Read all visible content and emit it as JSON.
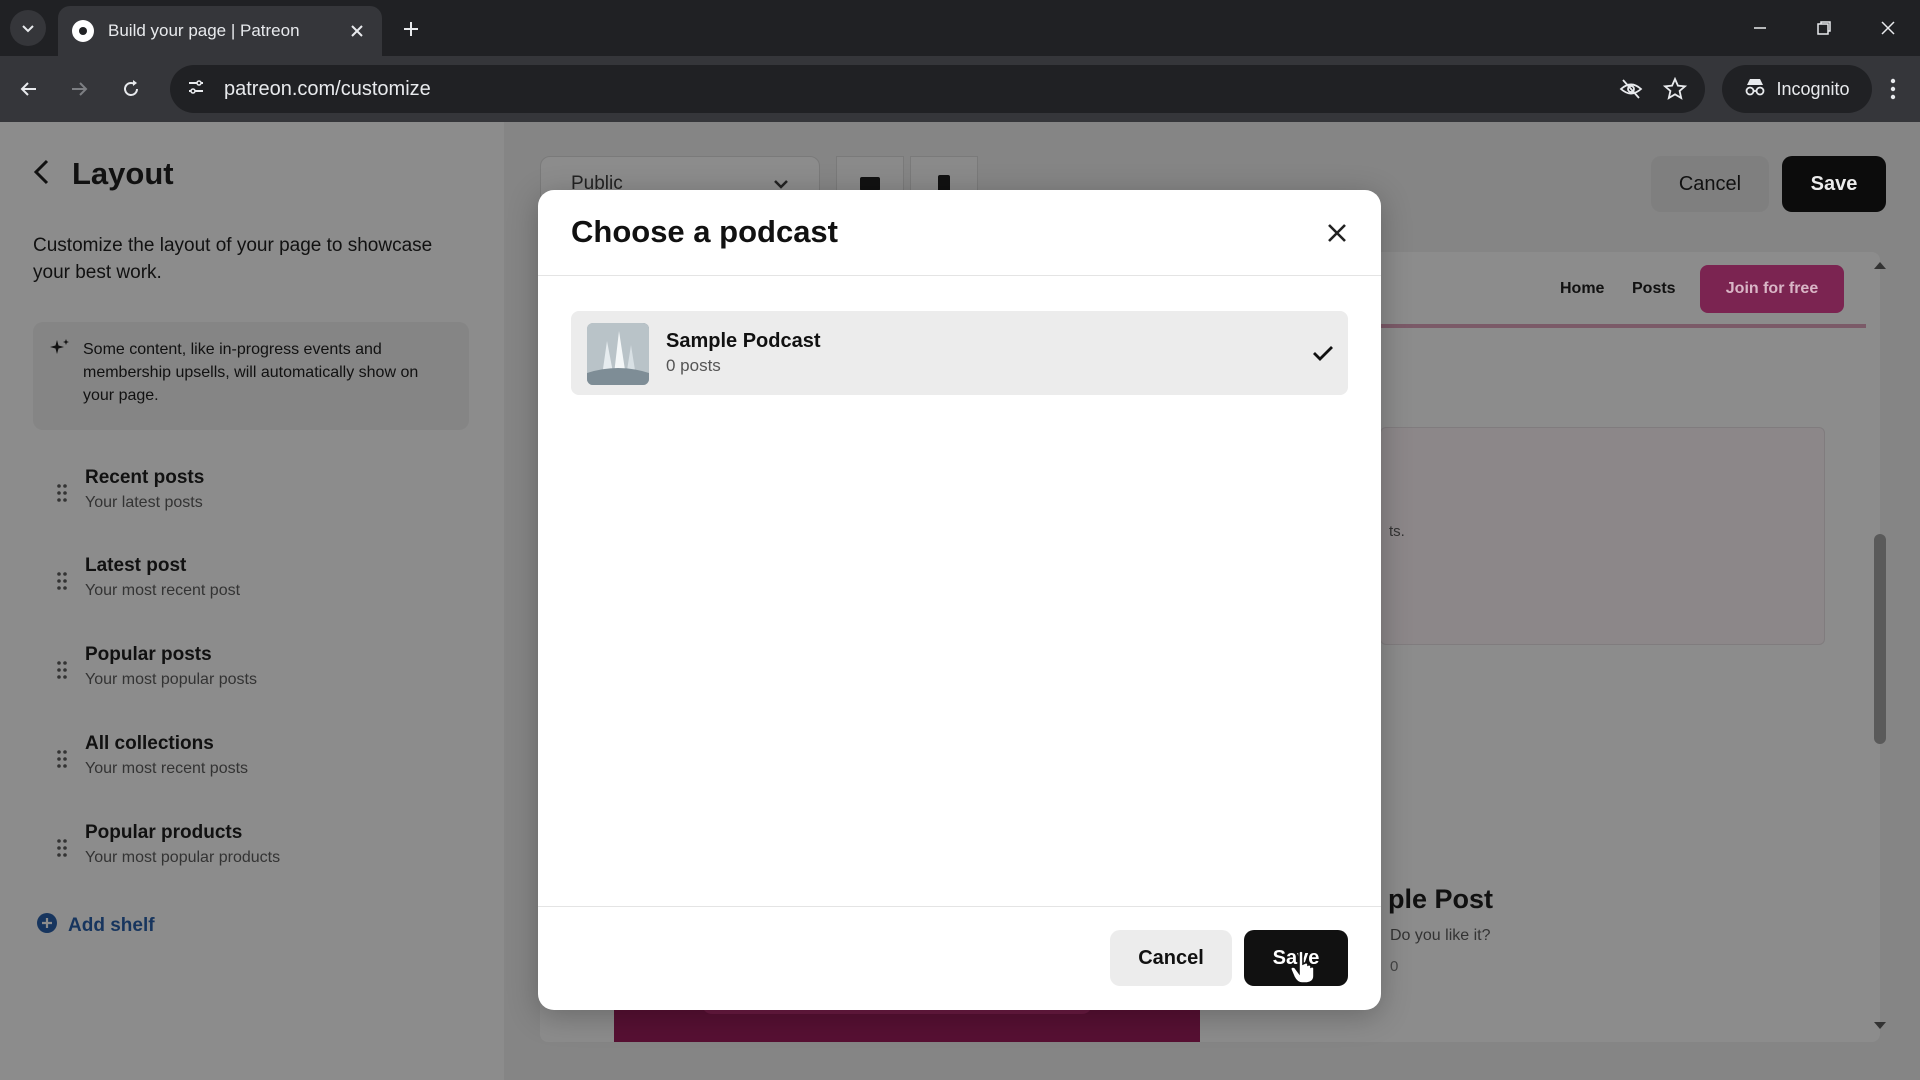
{
  "browser": {
    "tab_title": "Build your page | Patreon",
    "url": "patreon.com/customize",
    "incognito_label": "Incognito",
    "icons": [
      "tab-search-icon",
      "patreon-favicon",
      "close-icon",
      "plus-icon",
      "minimize-icon",
      "restore-icon",
      "window-close-icon",
      "back-icon",
      "forward-icon",
      "reload-icon",
      "site-settings-icon",
      "eye-off-icon",
      "star-icon",
      "incognito-icon",
      "menu-dots-icon"
    ]
  },
  "sidebar": {
    "title": "Layout",
    "description": "Customize the layout of your page to showcase your best work.",
    "info": "Some content, like in-progress events and membership upsells, will automatically show on your page.",
    "shelves": [
      {
        "name": "Recent posts",
        "subtitle": "Your latest posts"
      },
      {
        "name": "Latest post",
        "subtitle": "Your most recent post"
      },
      {
        "name": "Popular posts",
        "subtitle": "Your most popular posts"
      },
      {
        "name": "All collections",
        "subtitle": "Your most recent posts"
      },
      {
        "name": "Popular products",
        "subtitle": "Your most popular products"
      }
    ],
    "add_shelf_label": "Add shelf"
  },
  "editor": {
    "visibility_selected": "Public",
    "cancel_label": "Cancel",
    "save_label": "Save"
  },
  "preview": {
    "nav": {
      "home": "Home",
      "posts": "Posts",
      "join": "Join for free"
    },
    "card_fragment": "ts.",
    "post_title_fragment": "ple Post",
    "post_desc_fragment": "Do you like it?",
    "post_count_fragment": "0"
  },
  "modal": {
    "title": "Choose a podcast",
    "podcasts": [
      {
        "name": "Sample Podcast",
        "count": "0 posts",
        "selected": true
      }
    ],
    "cancel_label": "Cancel",
    "save_label": "Save"
  },
  "colors": {
    "brand_join": "#7b2451",
    "primary_button": "#111111",
    "overlay_dim": "#8a8a8a"
  }
}
